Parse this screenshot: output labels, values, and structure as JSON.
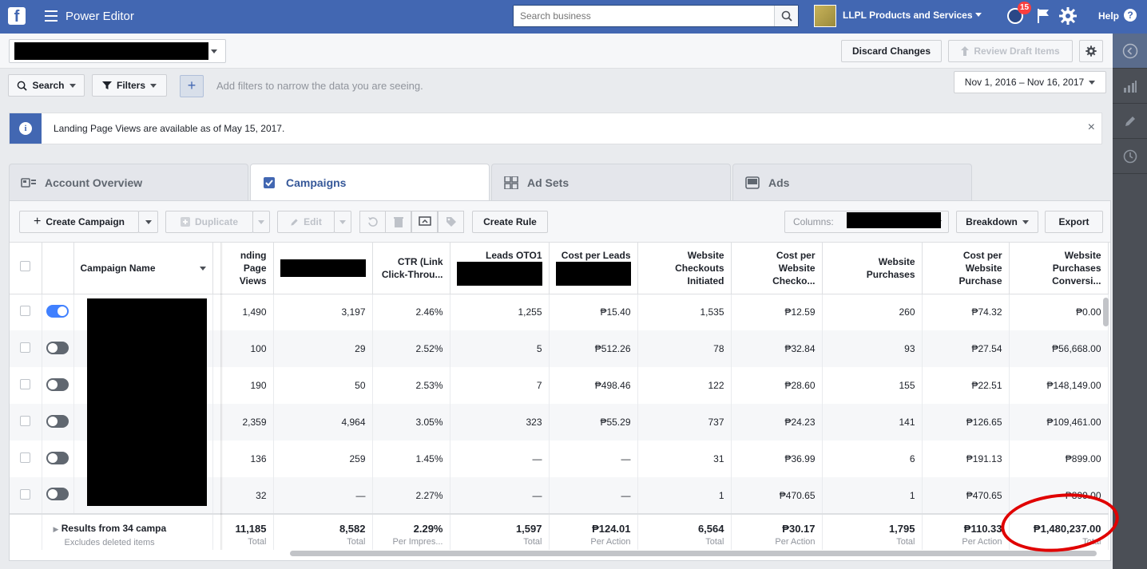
{
  "topbar": {
    "logo": "f",
    "app_title": "Power Editor",
    "search_placeholder": "Search business",
    "business_name": "LLPL Products and Services",
    "notification_count": "15",
    "help_label": "Help",
    "help_glyph": "?"
  },
  "toolbar_top": {
    "discard_label": "Discard Changes",
    "review_label": "Review Draft Items"
  },
  "filters": {
    "search_label": "Search",
    "filters_label": "Filters",
    "add_symbol": "+",
    "hint": "Add filters to narrow the data you are seeing.",
    "date_range": "Nov 1, 2016 – Nov 16, 2017"
  },
  "notice": {
    "info_glyph": "i",
    "message": "Landing Page Views are available as of May 15, 2017.",
    "close_glyph": "×"
  },
  "tabs": [
    {
      "label": "Account Overview",
      "icon": "account-overview-icon"
    },
    {
      "label": "Campaigns",
      "icon": "checkbox-icon"
    },
    {
      "label": "Ad Sets",
      "icon": "grid-icon"
    },
    {
      "label": "Ads",
      "icon": "ad-preview-icon"
    }
  ],
  "actions": {
    "create_campaign": "Create Campaign",
    "duplicate": "Duplicate",
    "edit": "Edit",
    "create_rule": "Create Rule",
    "columns_label": "Columns:",
    "breakdown": "Breakdown",
    "export": "Export"
  },
  "table": {
    "headers": {
      "campaign_name": "Campaign Name",
      "landing_page_views": "nding Page Views",
      "ctr": "CTR (Link Click-Throu...",
      "leads_oto1": "Leads OTO1",
      "cost_per_leads": "Cost per Leads",
      "checkouts": "Website Checkouts Initiated",
      "cost_checkout": "Cost per Website Checko...",
      "purchases": "Website Purchases",
      "cost_purchase": "Cost per Website Purchase",
      "purchase_conv": "Website Purchases Conversi..."
    },
    "rows": [
      {
        "on": true,
        "lpv": "1,490",
        "c2": "3,197",
        "ctr": "2.46%",
        "leads": "1,255",
        "cpl": "₱15.40",
        "chk": "1,535",
        "cpc": "₱12.59",
        "pur": "260",
        "cpp": "₱74.32",
        "conv": "₱0.00"
      },
      {
        "on": false,
        "lpv": "100",
        "c2": "29",
        "ctr": "2.52%",
        "leads": "5",
        "cpl": "₱512.26",
        "chk": "78",
        "cpc": "₱32.84",
        "pur": "93",
        "cpp": "₱27.54",
        "conv": "₱56,668.00"
      },
      {
        "on": false,
        "lpv": "190",
        "c2": "50",
        "ctr": "2.53%",
        "leads": "7",
        "cpl": "₱498.46",
        "chk": "122",
        "cpc": "₱28.60",
        "pur": "155",
        "cpp": "₱22.51",
        "conv": "₱148,149.00"
      },
      {
        "on": false,
        "lpv": "2,359",
        "c2": "4,964",
        "ctr": "3.05%",
        "leads": "323",
        "cpl": "₱55.29",
        "chk": "737",
        "cpc": "₱24.23",
        "pur": "141",
        "cpp": "₱126.65",
        "conv": "₱109,461.00"
      },
      {
        "on": false,
        "lpv": "136",
        "c2": "259",
        "ctr": "1.45%",
        "leads": "—",
        "cpl": "—",
        "chk": "31",
        "cpc": "₱36.99",
        "pur": "6",
        "cpp": "₱191.13",
        "conv": "₱899.00"
      },
      {
        "on": false,
        "lpv": "32",
        "c2": "—",
        "ctr": "2.27%",
        "leads": "—",
        "cpl": "—",
        "chk": "1",
        "cpc": "₱470.65",
        "pur": "1",
        "cpp": "₱470.65",
        "conv": "₱899.00"
      }
    ],
    "totals": {
      "results_label": "Results from 34 campa",
      "excludes_label": "Excludes deleted items",
      "lpv": "11,185",
      "lpv_l": "Total",
      "c2": "8,582",
      "c2_l": "Total",
      "ctr": "2.29%",
      "ctr_l": "Per Impres...",
      "leads": "1,597",
      "leads_l": "Total",
      "cpl": "₱124.01",
      "cpl_l": "Per Action",
      "chk": "6,564",
      "chk_l": "Total",
      "cpc": "₱30.17",
      "cpc_l": "Per Action",
      "pur": "1,795",
      "pur_l": "Total",
      "cpp": "₱110.33",
      "cpp_l": "Per Action",
      "conv": "₱1,480,237.00",
      "conv_l": "Total"
    }
  }
}
